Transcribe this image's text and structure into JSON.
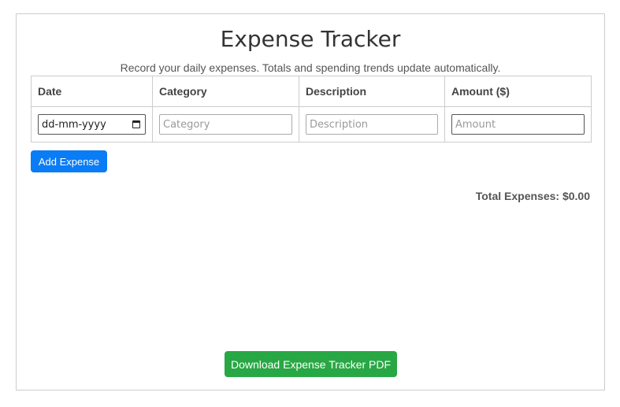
{
  "title": "Expense Tracker",
  "subtitle": "Record your daily expenses. Totals and spending trends update automatically.",
  "table": {
    "headers": [
      "Date",
      "Category",
      "Description",
      "Amount ($)"
    ],
    "inputs": {
      "date_value": "dd-mm-yyyy",
      "category_placeholder": "Category",
      "description_placeholder": "Description",
      "amount_placeholder": "Amount"
    }
  },
  "buttons": {
    "add_expense": "Add Expense",
    "download_pdf": "Download Expense Tracker PDF"
  },
  "total": {
    "label": "Total Expenses:",
    "value": "$0.00"
  },
  "colors": {
    "primary_button": "#0a7cf5",
    "success_button": "#28a745"
  },
  "icons": {
    "date_picker": "calendar-icon"
  }
}
